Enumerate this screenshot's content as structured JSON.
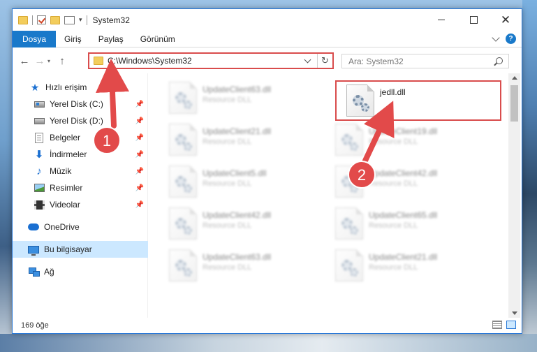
{
  "window": {
    "title": "System32",
    "address_path": "C:\\Windows\\System32",
    "search_placeholder": "Ara: System32"
  },
  "ribbon": {
    "tabs": [
      "Dosya",
      "Giriş",
      "Paylaş",
      "Görünüm"
    ]
  },
  "nav": {
    "items": [
      {
        "label": "Hızlı erişim",
        "icon": "star-icon",
        "pinned": false
      },
      {
        "label": "Yerel Disk (C:)",
        "icon": "drive-icon",
        "pinned": true
      },
      {
        "label": "Yerel Disk (D:)",
        "icon": "drive-icon",
        "pinned": true
      },
      {
        "label": "Belgeler",
        "icon": "documents-icon",
        "pinned": true
      },
      {
        "label": "İndirmeler",
        "icon": "download-icon",
        "pinned": true
      },
      {
        "label": "Müzik",
        "icon": "music-icon",
        "pinned": true
      },
      {
        "label": "Resimler",
        "icon": "pictures-icon",
        "pinned": true
      },
      {
        "label": "Videolar",
        "icon": "videos-icon",
        "pinned": true
      },
      {
        "label": "OneDrive",
        "icon": "cloud-icon",
        "pinned": false
      },
      {
        "label": "Bu bilgisayar",
        "icon": "computer-icon",
        "pinned": false,
        "selected": true
      },
      {
        "label": "Ağ",
        "icon": "network-icon",
        "pinned": false
      }
    ]
  },
  "files": {
    "target": {
      "name": "jedll.dll",
      "type": ""
    },
    "items": [
      {
        "name": "UpdateClient63.dll",
        "type": "Resource DLL"
      },
      {
        "name": "UpdateClient21.dll",
        "type": "Resource DLL"
      },
      {
        "name": "UpdateClient19.dll",
        "type": "Resource DLL"
      },
      {
        "name": "UpdateClient5.dll",
        "type": "Resource DLL"
      },
      {
        "name": "UpdateClient42.dll",
        "type": "Resource DLL"
      },
      {
        "name": "UpdateClient42.dll",
        "type": "Resource DLL"
      },
      {
        "name": "UpdateClient65.dll",
        "type": "Resource DLL"
      },
      {
        "name": "UpdateClient63.dll",
        "type": "Resource DLL"
      },
      {
        "name": "UpdateClient21.dll",
        "type": "Resource DLL"
      }
    ]
  },
  "status": {
    "count": "169 öğe"
  },
  "markers": [
    "1",
    "2"
  ],
  "colors": {
    "accent": "#1979ca",
    "highlight": "#d94c4c",
    "selected": "#cce8ff"
  }
}
